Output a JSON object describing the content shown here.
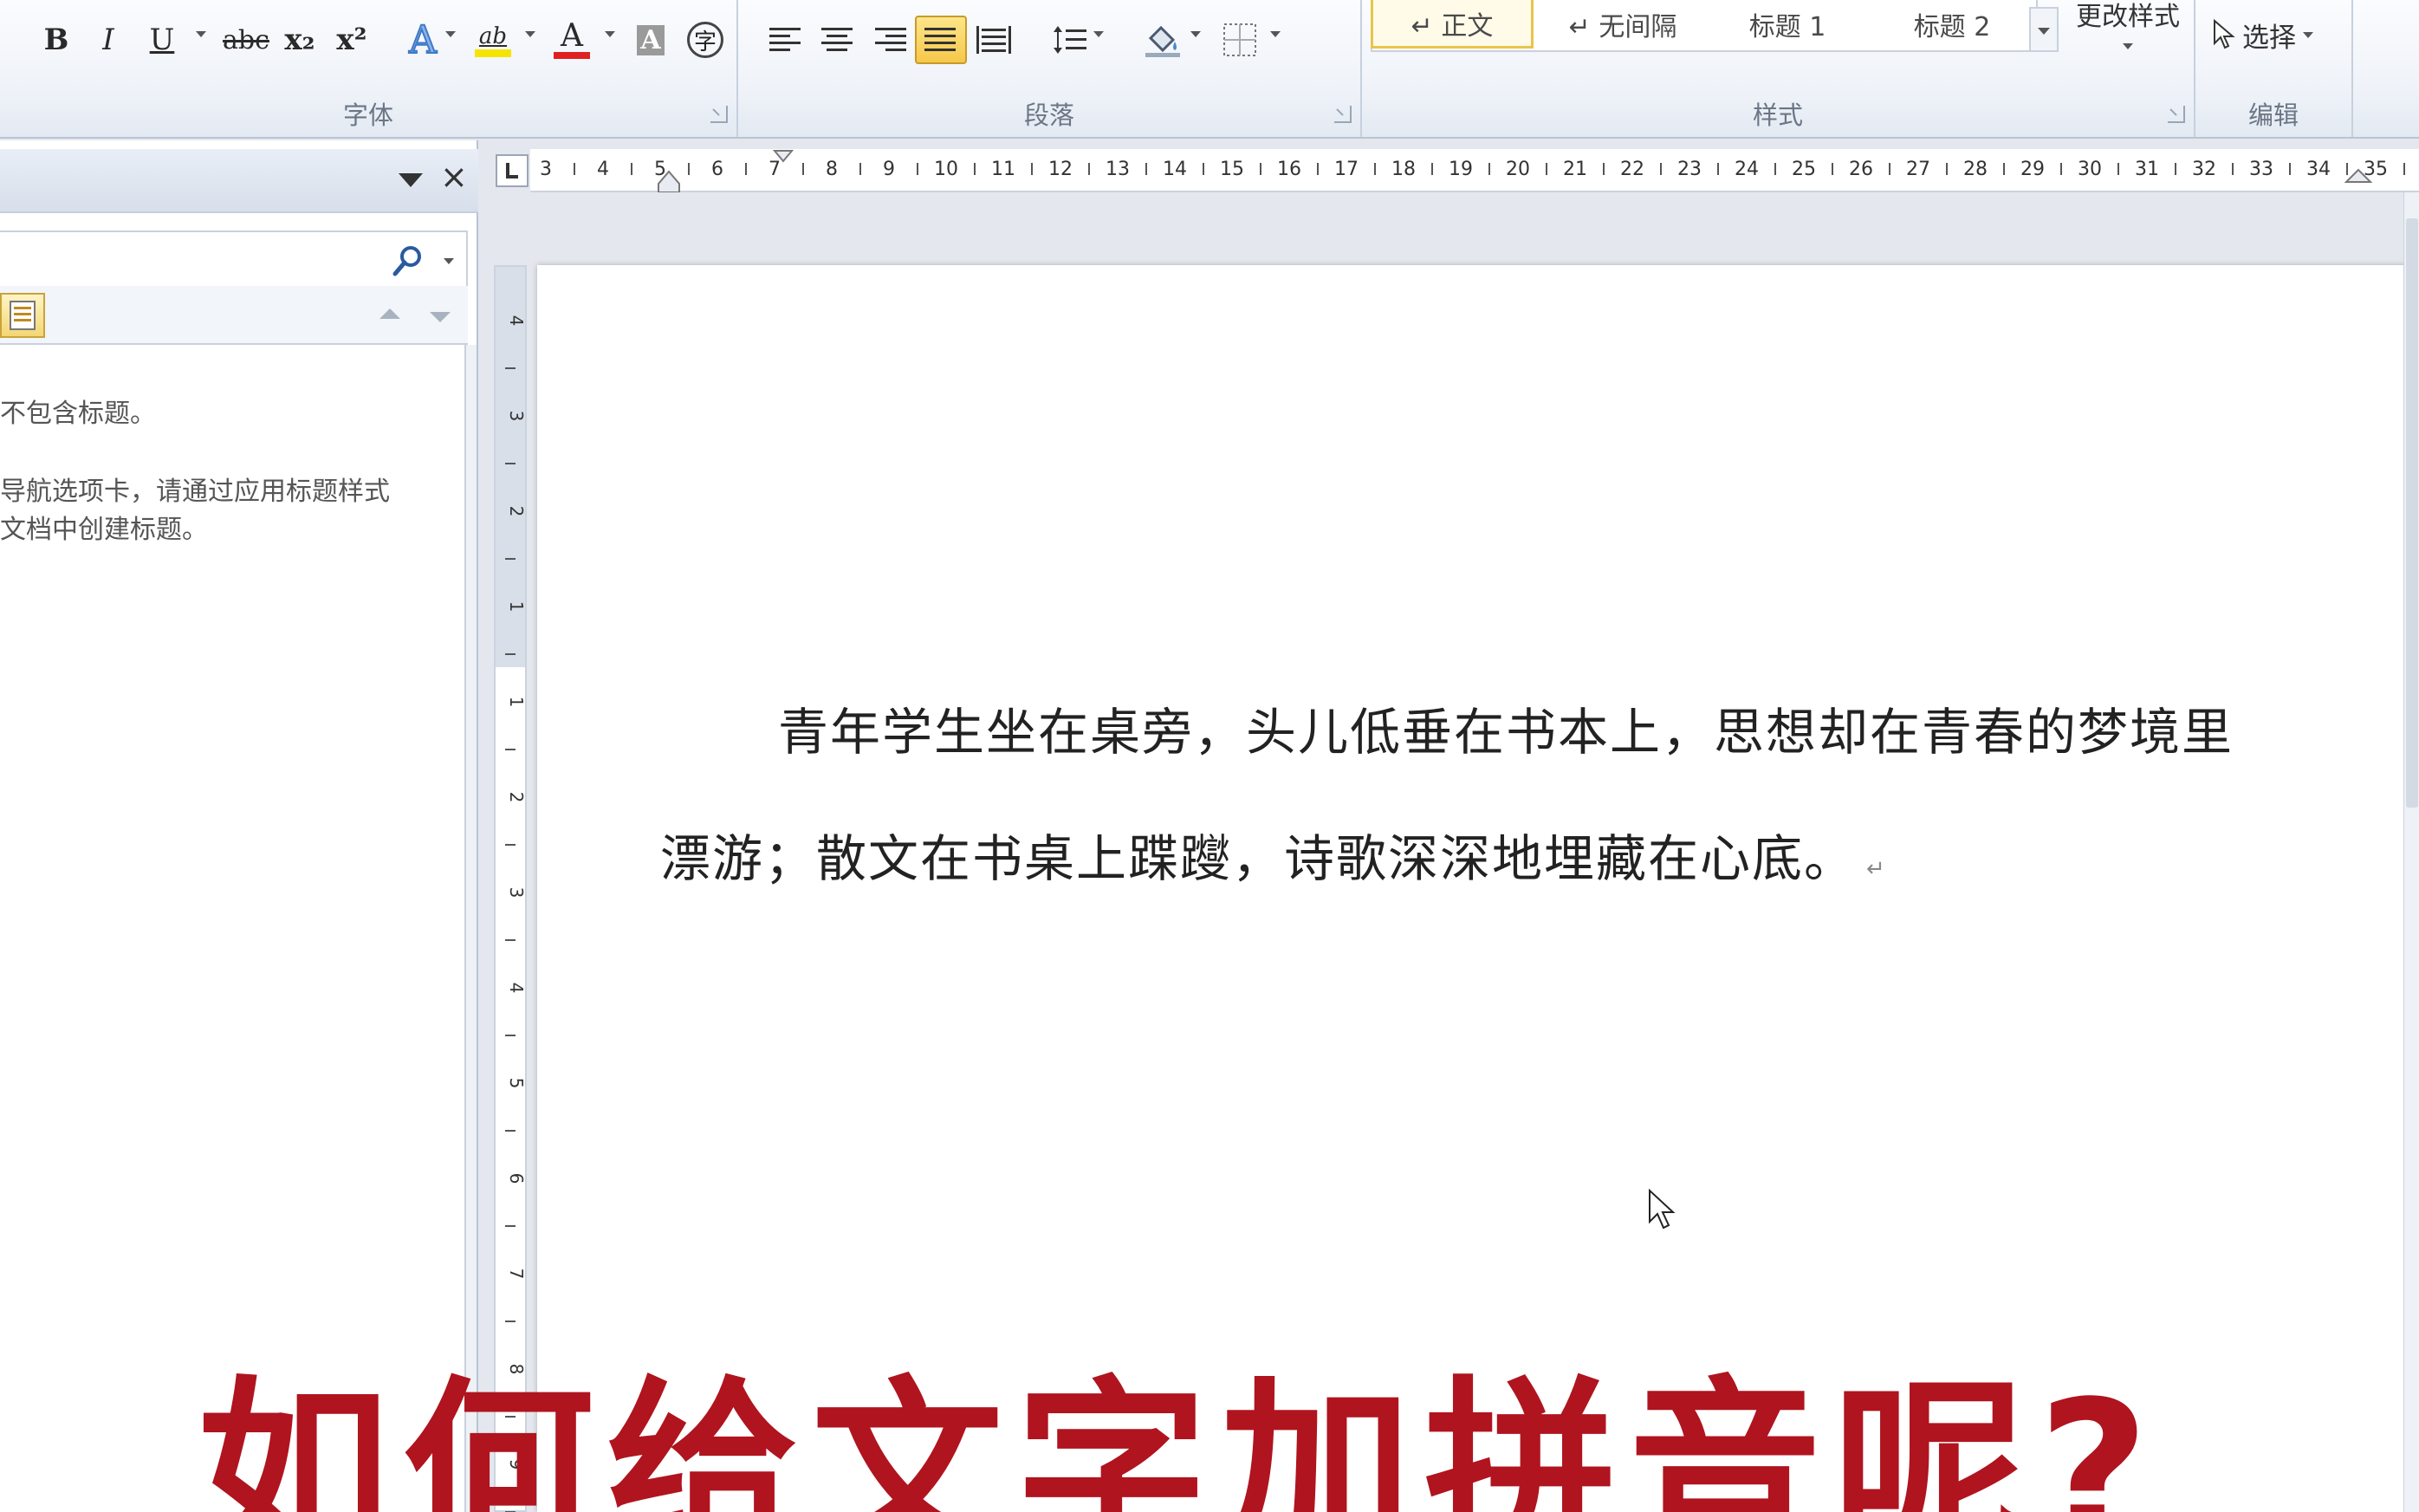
{
  "ribbon": {
    "font_group": {
      "label": "字体",
      "bold": "B",
      "italic": "I",
      "underline": "U",
      "strike": "abc",
      "subscript": "x₂",
      "superscript": "x²",
      "text_effects": "A",
      "highlight": "ab",
      "font_color": "A",
      "char_shading": "A",
      "enclose_char": "字"
    },
    "paragraph_group": {
      "label": "段落"
    },
    "styles_group": {
      "label": "样式",
      "styles": [
        "↵ 正文",
        "↵ 无间隔",
        "标题 1",
        "标题 2"
      ],
      "change_styles": "更改样式"
    },
    "editing_group": {
      "label": "编辑",
      "select": "选择"
    }
  },
  "nav_pane": {
    "message_line1": "不包含标题。",
    "message_line2": "导航选项卡，请通过应用标题样式",
    "message_line3": "文档中创建标题。"
  },
  "ruler": {
    "ticks": [
      "3",
      "4",
      "5",
      "6",
      "7",
      "8",
      "9",
      "10",
      "11",
      "12",
      "13",
      "14",
      "15",
      "16",
      "17",
      "18",
      "19",
      "20",
      "21",
      "22",
      "23",
      "24",
      "25",
      "26",
      "27",
      "28",
      "29",
      "30",
      "31",
      "32",
      "33",
      "34",
      "35"
    ],
    "vertical_ticks": [
      "4",
      "3",
      "2",
      "1",
      "1",
      "2",
      "3",
      "4",
      "5",
      "6",
      "7",
      "8",
      "9"
    ]
  },
  "document": {
    "line1": "青年学生坐在桌旁，头儿低垂在书本上，思想却在青春的梦境里",
    "line2": "漂游；散文在书桌上蹀躞，诗歌深深地埋藏在心底。",
    "pilcrow": "↵"
  },
  "overlay": {
    "title": "如何给文字加拼音呢?"
  },
  "colors": {
    "overlay_red": "#b0141f",
    "active_style_border": "#e8c54a",
    "highlight_yellow": "#f5e400",
    "font_color_red": "#e02020"
  }
}
